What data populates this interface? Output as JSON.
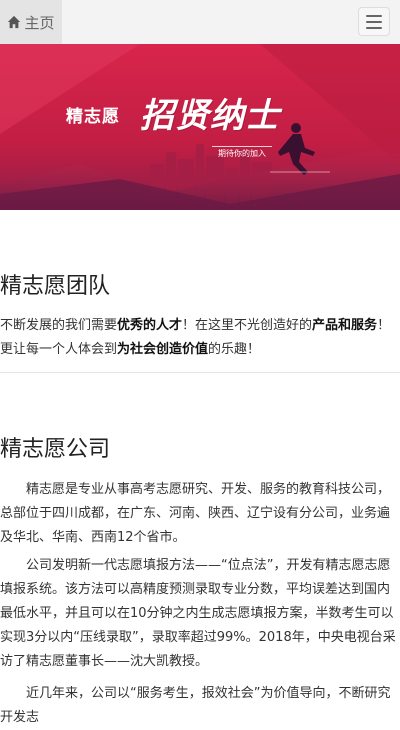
{
  "nav": {
    "home_label": "主页",
    "home_icon": "home-icon",
    "menu_icon": "hamburger-menu-icon"
  },
  "banner": {
    "brand": "精志愿",
    "slogan": "招贤纳士",
    "tagline": "期待你的加入",
    "colors": {
      "primary": "#d8254b",
      "dark": "#8b1f47"
    }
  },
  "team": {
    "title": "精志愿团队",
    "p_1": "不断发展的我们需要",
    "p_2": "优秀的人才",
    "p_3": "！在这里不光创造好的",
    "p_4": "产品和服务",
    "p_5": "！更让每一个人体会到",
    "p_6": "为社会创造价值",
    "p_7": "的乐趣！"
  },
  "company": {
    "title": "精志愿公司",
    "para1": "精志愿是专业从事高考志愿研究、开发、服务的教育科技公司，总部位于四川成都，在广东、河南、陕西、辽宁设有分公司，业务遍及华北、华南、西南12个省市。",
    "para2": "公司发明新一代志愿填报方法——“位点法”，开发有精志愿志愿填报系统。该方法可以高精度预测录取专业分数，平均误差达到国内最低水平，并且可以在10分钟之内生成志愿填报方案，半数考生可以实现3分以内“压线录取”，录取率超过99%。2018年，中央电视台采访了精志愿董事长——沈大凯教授。",
    "para3": "近几年来，公司以“服务考生，报效社会”为价值导向，不断研究开发志"
  }
}
